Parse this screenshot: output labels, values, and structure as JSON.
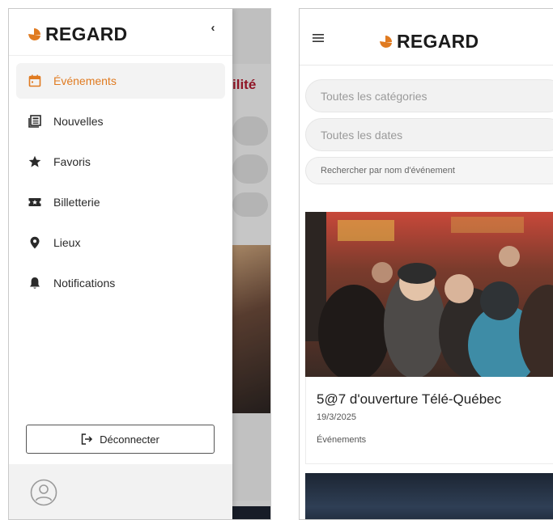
{
  "brand": {
    "name": "REGARD",
    "accent": "#e07b21"
  },
  "drawer": {
    "collapse_icon": "chevron-left-icon",
    "items": [
      {
        "label": "Événements",
        "icon": "calendar-icon",
        "active": true
      },
      {
        "label": "Nouvelles",
        "icon": "newspaper-icon",
        "active": false
      },
      {
        "label": "Favoris",
        "icon": "star-icon",
        "active": false
      },
      {
        "label": "Billetterie",
        "icon": "ticket-icon",
        "active": false
      },
      {
        "label": "Lieux",
        "icon": "map-pin-icon",
        "active": false
      },
      {
        "label": "Notifications",
        "icon": "bell-icon",
        "active": false
      }
    ],
    "logout_label": "Déconnecter",
    "avatar_icon": "user-circle-icon"
  },
  "background_page": {
    "title_fragment": "ilité"
  },
  "main": {
    "menu_icon": "hamburger-icon",
    "filters": {
      "category": "Toutes les catégories",
      "dates": "Toutes les dates",
      "search_placeholder": "Rechercher par nom d'événement"
    },
    "events": [
      {
        "title": "5@7 d'ouverture Télé-Québec",
        "date": "19/3/2025",
        "category": "Événements"
      }
    ]
  }
}
